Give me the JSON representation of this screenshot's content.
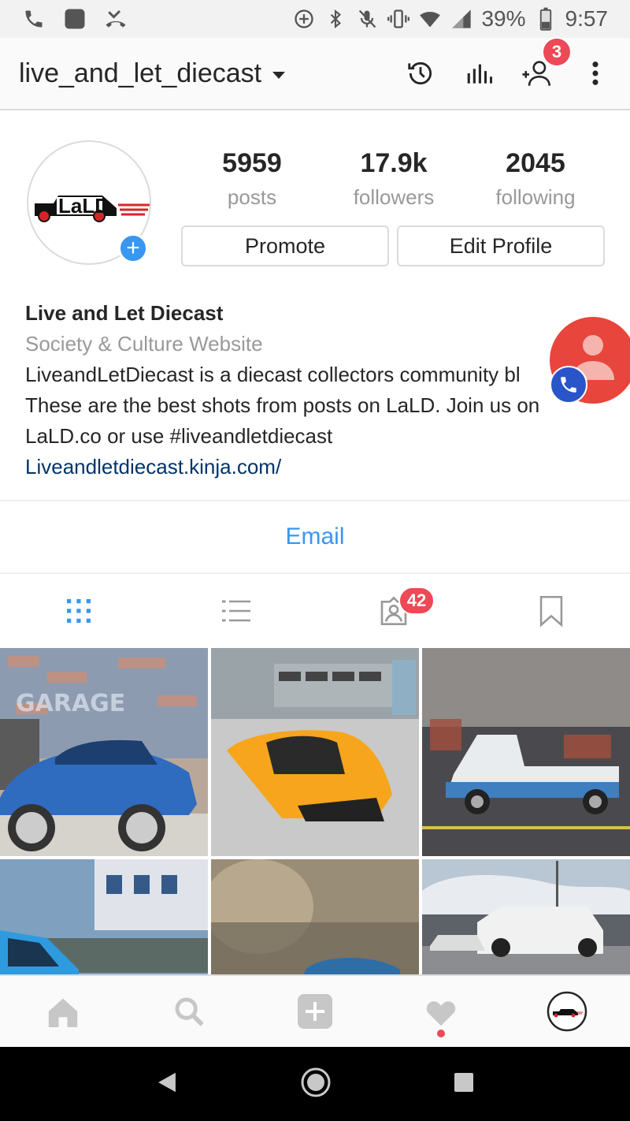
{
  "status_bar": {
    "battery": "39%",
    "time": "9:57"
  },
  "header": {
    "username": "live_and_let_diecast",
    "notification_count": "3"
  },
  "profile": {
    "avatar_logo_text": "LaLD",
    "stats": [
      {
        "value": "5959",
        "label": "posts"
      },
      {
        "value": "17.9k",
        "label": "followers"
      },
      {
        "value": "2045",
        "label": "following"
      }
    ],
    "promote_label": "Promote",
    "edit_profile_label": "Edit Profile"
  },
  "bio": {
    "name": "Live and Let Diecast",
    "category": "Society & Culture Website",
    "lines": [
      "LiveandLetDiecast is a diecast collectors community bl",
      "These are the best shots from posts on LaLD. Join us on",
      "LaLD.co or use #liveandletdiecast"
    ],
    "link": "Liveandletdiecast.kinja.com/"
  },
  "contact": {
    "email_label": "Email"
  },
  "tabs": {
    "tagged_badge": "42"
  },
  "colors": {
    "accent_blue": "#3897f0",
    "badge_red": "#ed4956",
    "link_blue": "#003569",
    "fab_red": "#e8453c"
  }
}
